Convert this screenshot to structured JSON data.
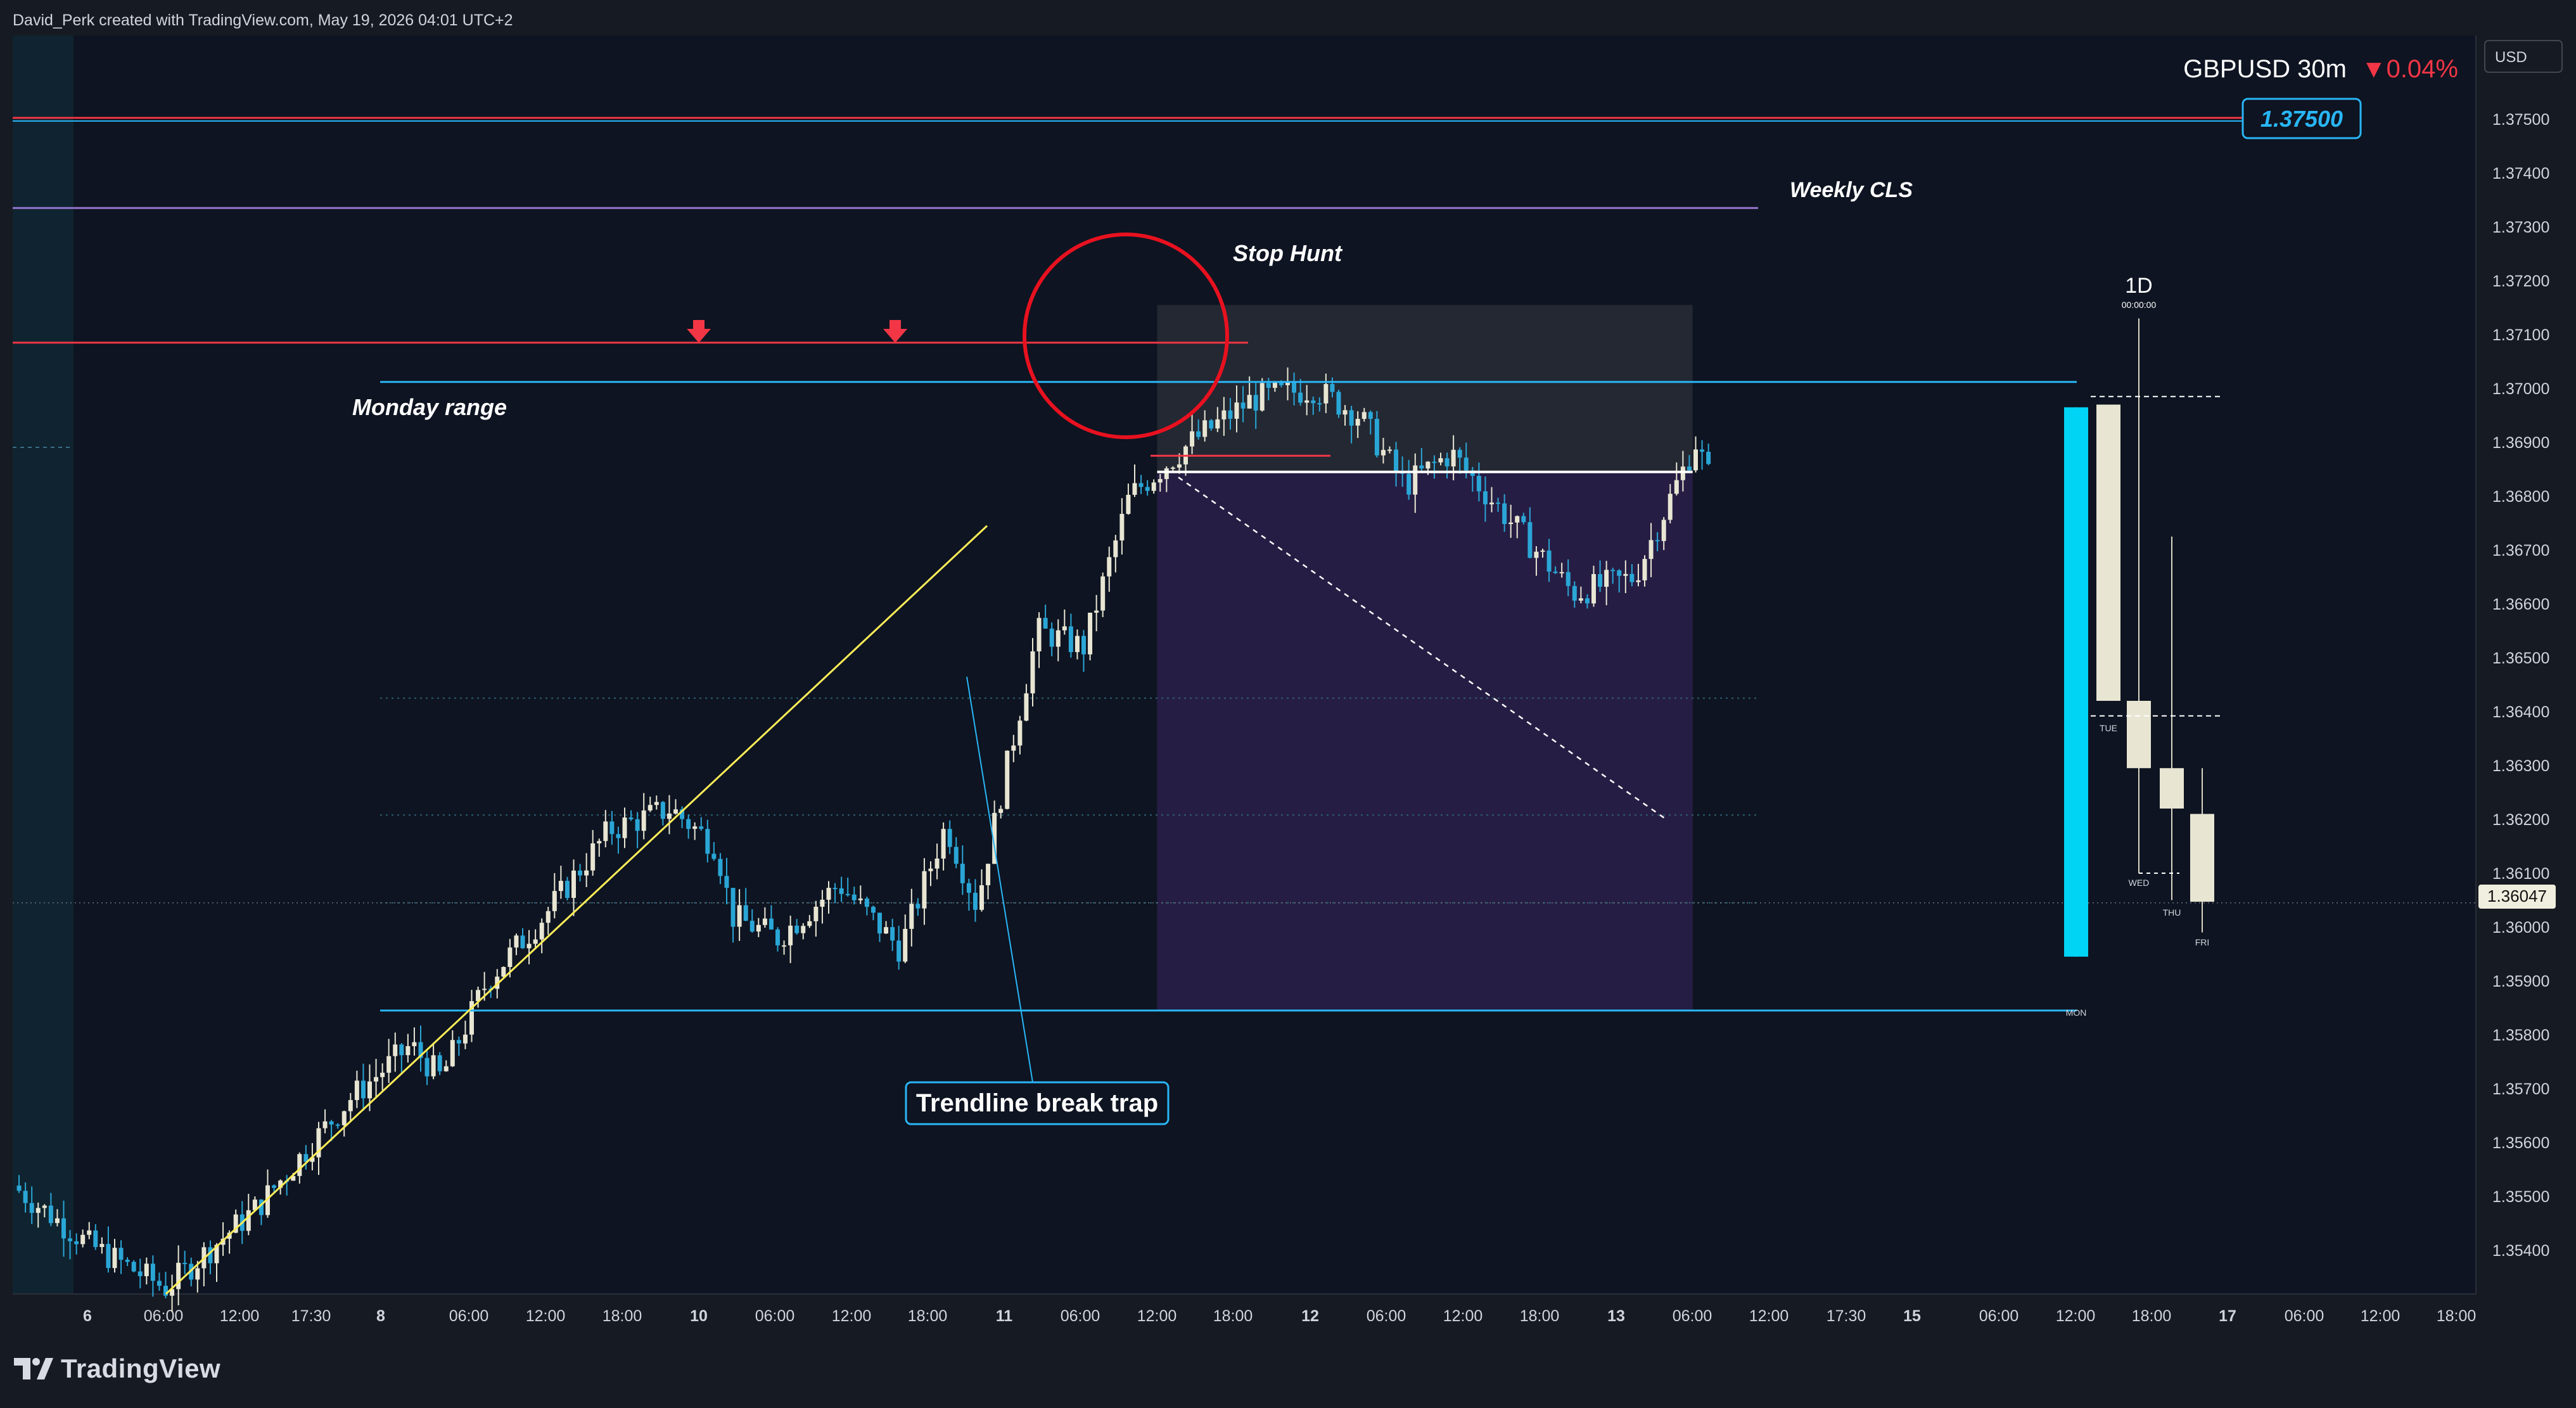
{
  "header": {
    "credit": "David_Perk created with TradingView.com, May 19, 2026 04:01 UTC+2"
  },
  "branding": {
    "logo_text": "TradingView"
  },
  "symbol": {
    "name": "GBPUSD 30m",
    "change": "▼0.04%",
    "change_color": "#f23645"
  },
  "currency_button": "USD",
  "price_badges": {
    "key_level": "1.37500",
    "current": "1.36047"
  },
  "annotations": {
    "weekly_cls": "Weekly CLS",
    "stop_hunt": "Stop Hunt",
    "monday_range": "Monday range",
    "trendline_trap": "Trendline break trap"
  },
  "htf_panel": {
    "timeframe": "1D",
    "time": "00:00:00",
    "day_labels": [
      "MON",
      "TUE",
      "WED",
      "THU",
      "FRI"
    ]
  },
  "colors": {
    "background": "#0e1421",
    "bull_candle": "#e8e6d3",
    "bear_candle": "#2aa6d6",
    "monday_range": "#29b6f6",
    "key_level": "#f23645",
    "weekly_cls": "#9575cd",
    "trendline": "#ffee58",
    "stop_hunt_circle": "#e8111f",
    "htf_bull": "#e8e6d3",
    "htf_monday": "#00d4f5"
  },
  "chart_data": {
    "type": "candlestick",
    "symbol": "GBPUSD",
    "timeframe": "30m",
    "ylim": [
      1.3532,
      1.3768
    ],
    "y_ticks": [
      "1.37500",
      "1.37400",
      "1.37300",
      "1.37200",
      "1.37100",
      "1.37000",
      "1.36900",
      "1.36800",
      "1.36700",
      "1.36600",
      "1.36500",
      "1.36400",
      "1.36300",
      "1.36200",
      "1.36100",
      "1.36000",
      "1.35900",
      "1.35800",
      "1.35700",
      "1.35600",
      "1.35500",
      "1.35400"
    ],
    "x_ticks": [
      "6",
      "06:00",
      "12:00",
      "17:30",
      "8",
      "06:00",
      "12:00",
      "18:00",
      "10",
      "06:00",
      "12:00",
      "18:00",
      "11",
      "06:00",
      "12:00",
      "18:00",
      "12",
      "06:00",
      "12:00",
      "18:00",
      "13",
      "06:00",
      "12:00",
      "17:30",
      "15",
      "06:00",
      "12:00",
      "18:00",
      "17",
      "06:00",
      "12:00",
      "18:00"
    ],
    "levels": {
      "key_level_high": 1.375,
      "weekly_cls": 1.37335,
      "sell_side_level": 1.37085,
      "monday_range_high": 1.37012,
      "monday_range_low": 1.35845,
      "entry": 1.36845,
      "stop_marker": 1.36875,
      "dotted_levels": [
        1.36425,
        1.36208,
        1.36045
      ]
    },
    "trade_box": {
      "x_range": [
        "11 12:00",
        "13 06:00"
      ],
      "entry": 1.36845,
      "stop": 1.37155,
      "target": 1.35845
    },
    "trendline": {
      "from": [
        "7 21:00",
        1.35325
      ],
      "to": [
        "10 19:30",
        1.36745
      ]
    },
    "htf_daily_candles": [
      {
        "day": "MON",
        "open": 1.35945,
        "high": 1.36965,
        "low": 1.35945,
        "close": 1.36965,
        "color": "#00d4f5"
      },
      {
        "day": "TUE",
        "open": 1.3642,
        "high": 1.3697,
        "low": 1.3642,
        "close": 1.3697
      },
      {
        "day": "WED",
        "open": 1.3642,
        "high": 1.3713,
        "low": 1.361,
        "close": 1.36295
      },
      {
        "day": "THU",
        "open": 1.36295,
        "high": 1.36725,
        "low": 1.3605,
        "close": 1.3622
      },
      {
        "day": "FRI",
        "open": 1.3621,
        "high": 1.36295,
        "low": 1.3599,
        "close": 1.36047
      }
    ]
  }
}
